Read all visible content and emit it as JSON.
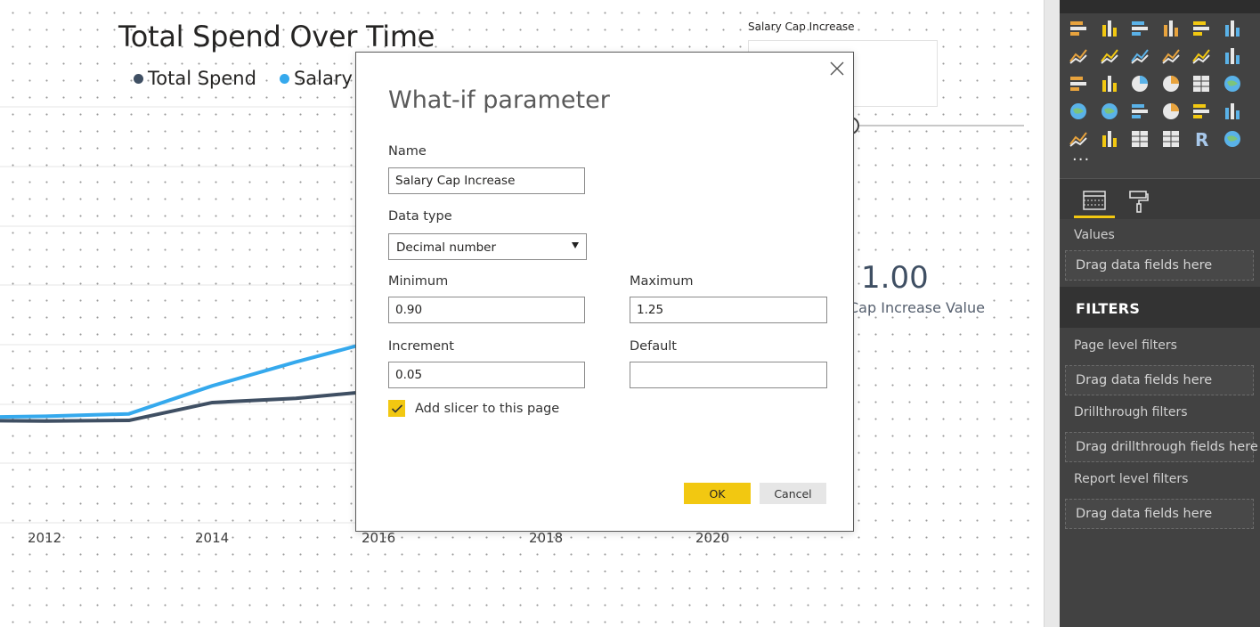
{
  "chart": {
    "title": "Total Spend Over Time",
    "legend": [
      {
        "name": "Total Spend",
        "color": "#3f4f63"
      },
      {
        "name": "Salary",
        "color": "#35a9ed"
      }
    ],
    "x_ticks": [
      "2012",
      "2014",
      "2016",
      "2018",
      "2020"
    ]
  },
  "chart_data": {
    "type": "line",
    "x": [
      2011,
      2012,
      2013,
      2014,
      2015,
      2016
    ],
    "series": [
      {
        "name": "Total Spend",
        "values": [
          0.82,
          0.81,
          0.82,
          1.12,
          1.19,
          1.32
        ]
      },
      {
        "name": "Salary",
        "values": [
          0.87,
          0.89,
          0.93,
          1.4,
          1.8,
          2.17
        ]
      }
    ]
  },
  "slicer": {
    "title": "Salary Cap Increase"
  },
  "card": {
    "value": "1.00",
    "label": "Cap Increase Value"
  },
  "dialog": {
    "title": "What-if parameter",
    "name_label": "Name",
    "name_value": "Salary Cap Increase",
    "data_type_label": "Data type",
    "data_type_value": "Decimal number",
    "minimum_label": "Minimum",
    "minimum_value": "0.90",
    "maximum_label": "Maximum",
    "maximum_value": "1.25",
    "increment_label": "Increment",
    "increment_value": "0.05",
    "default_label": "Default",
    "default_value": "",
    "add_slicer_label": "Add slicer to this page",
    "add_slicer_checked": true,
    "ok_label": "OK",
    "cancel_label": "Cancel"
  },
  "pane": {
    "more_label": "...",
    "values_label": "Values",
    "values_dropzone": "Drag data fields here",
    "filters_title": "FILTERS",
    "page_filters_label": "Page level filters",
    "page_filters_dropzone": "Drag data fields here",
    "drillthrough_label": "Drillthrough filters",
    "drillthrough_dropzone": "Drag drillthrough fields here",
    "report_filters_label": "Report level filters",
    "report_filters_dropzone": "Drag data fields here",
    "viz_icons": [
      "stacked-bar-icon",
      "stacked-column-icon",
      "clustered-bar-icon",
      "clustered-column-icon",
      "100-stacked-bar-icon",
      "100-stacked-column-icon",
      "line-chart-icon",
      "area-chart-icon",
      "stacked-area-icon",
      "line-column-icon",
      "line-stacked-column-icon",
      "ribbon-chart-icon",
      "waterfall-icon",
      "scatter-icon",
      "pie-chart-icon",
      "donut-chart-icon",
      "treemap-icon",
      "map-icon",
      "filled-map-icon",
      "shape-map-icon",
      "funnel-icon",
      "gauge-icon",
      "card-icon",
      "multi-row-card-icon",
      "kpi-icon",
      "slicer-icon",
      "table-icon",
      "matrix-icon",
      "r-visual-icon",
      "arcgis-icon"
    ],
    "colors": {
      "accent": "#f2c811",
      "pane_bg": "#424242"
    }
  }
}
